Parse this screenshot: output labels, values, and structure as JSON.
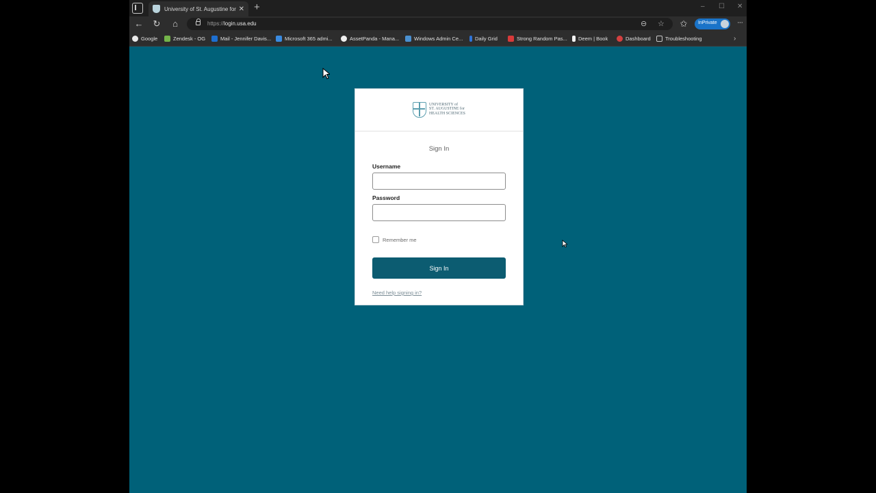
{
  "browser": {
    "tab": {
      "title": "University of St. Augustine for He"
    },
    "address": {
      "protocol": "https://",
      "host": "login.usa.edu"
    },
    "inprivate_label": "InPrivate",
    "favorites": [
      {
        "label": "Google",
        "color": "#e9e9e9"
      },
      {
        "label": "Zendesk - OG",
        "color": "#74b44a"
      },
      {
        "label": "Mail - Jennifer Davis...",
        "color": "#1e6fd0"
      },
      {
        "label": "Microsoft 365 admi...",
        "color": "#3a8be0"
      },
      {
        "label": "AssetPanda - Mana...",
        "color": "#f0f0f0"
      },
      {
        "label": "Windows Admin Ce...",
        "color": "#4a90d0"
      },
      {
        "label": "Daily Grid",
        "color": "#2f74d8"
      },
      {
        "label": "Strong Random Pas...",
        "color": "#d83a3a"
      },
      {
        "label": "Deem | Book",
        "color": "#f2f2f2"
      },
      {
        "label": "Dashboard",
        "color": "#d44040"
      },
      {
        "label": "Troubleshooting",
        "color": "#c8c8c8"
      }
    ]
  },
  "login": {
    "logo_lines": [
      "UNIVERSITY of",
      "ST. AUGUSTINE for",
      "HEALTH SCIENCES"
    ],
    "title": "Sign In",
    "username_label": "Username",
    "password_label": "Password",
    "remember_label": "Remember me",
    "signin_button": "Sign In",
    "help_link": "Need help signing in?"
  },
  "colors": {
    "page_background": "#006179",
    "button": "#0c5c71"
  }
}
